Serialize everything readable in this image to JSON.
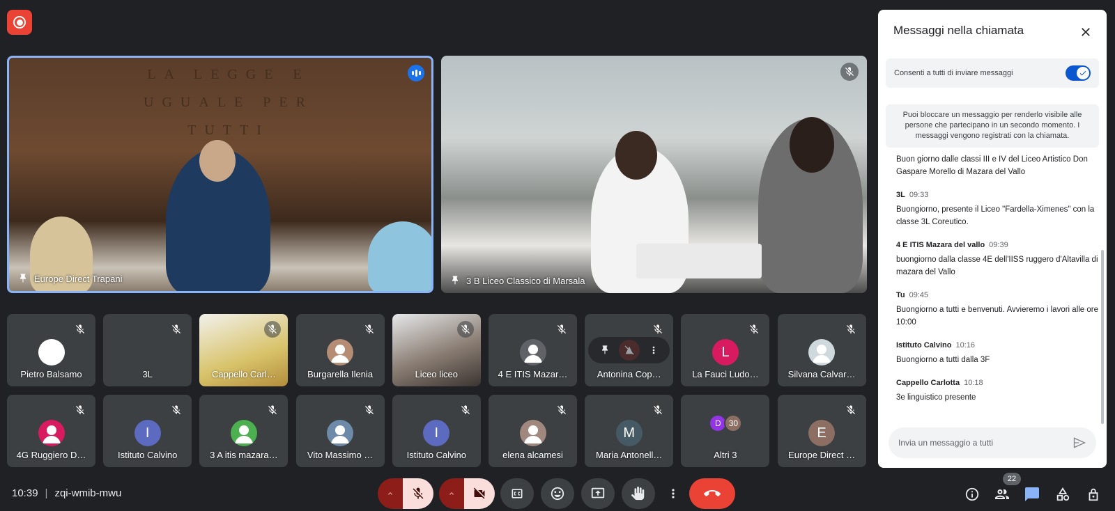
{
  "meeting": {
    "time": "10:39",
    "code": "zqi-wmib-mwu"
  },
  "main_tiles": [
    {
      "name": "Europe Direct Trapani",
      "wall_text": "LA LEGGE E UGUALE PER TUTTI",
      "speaking": true
    },
    {
      "name": "3 B Liceo Classico di Marsala",
      "muted": true
    }
  ],
  "participants_row1": [
    {
      "name": "Pietro Balsamo",
      "type": "photo-avatar",
      "color": "#ffffff"
    },
    {
      "name": "3L",
      "type": "video"
    },
    {
      "name": "Cappello Carl…",
      "type": "video"
    },
    {
      "name": "Burgarella Ilenia",
      "type": "photo-avatar",
      "color": "#b58c74"
    },
    {
      "name": "Liceo liceo",
      "type": "video"
    },
    {
      "name": "4 E ITIS Mazar…",
      "type": "default-avatar",
      "color": "#5f6368"
    },
    {
      "name": "Antonina Cop…",
      "type": "hover"
    },
    {
      "name": "La Fauci Ludo…",
      "type": "letter",
      "letter": "L",
      "color": "#d81b60"
    },
    {
      "name": "Silvana Calvar…",
      "type": "photo-avatar",
      "color": "#cfd8dc"
    }
  ],
  "participants_row2": [
    {
      "name": "4G Ruggiero D…",
      "type": "default-avatar",
      "color": "#d81b60"
    },
    {
      "name": "Istituto Calvino",
      "type": "letter",
      "letter": "I",
      "color": "#5c6bc0"
    },
    {
      "name": "3 A itis mazara…",
      "type": "default-avatar",
      "color": "#4caf50"
    },
    {
      "name": "Vito Massimo …",
      "type": "photo-avatar",
      "color": "#6d8aa8"
    },
    {
      "name": "Istituto Calvino",
      "type": "letter",
      "letter": "I",
      "color": "#5c6bc0"
    },
    {
      "name": "elena alcamesi",
      "type": "photo-avatar",
      "color": "#a1887f"
    },
    {
      "name": "Maria Antonell…",
      "type": "letter",
      "letter": "M",
      "color": "#455a64"
    },
    {
      "name": "Altri 3",
      "type": "others",
      "letter": "D",
      "count": "30",
      "color": "#9334e6",
      "color2": "#8d6e63"
    },
    {
      "name": "Europe Direct …",
      "type": "letter",
      "letter": "E",
      "color": "#8d6e63"
    }
  ],
  "panel": {
    "title": "Messaggi nella chiamata",
    "toggle_label": "Consenti a tutti di inviare messaggi",
    "toggle_on": true,
    "info": "Puoi bloccare un messaggio per renderlo visibile alle persone che partecipano in un secondo momento. I messaggi vengono registrati con la chiamata.",
    "first_message": "Buon giorno dalle classi III e IV del Liceo Artistico Don Gaspare Morello di Mazara del Vallo",
    "messages": [
      {
        "author": "3L",
        "time": "09:33",
        "text": "Buongiorno, presente il Liceo \"Fardella-Ximenes\" con la classe 3L Coreutico."
      },
      {
        "author": "4 E ITIS Mazara del vallo",
        "time": "09:39",
        "text": "buongiorno dalla classe 4E dell'IISS ruggero d'Altavilla di mazara del Vallo"
      },
      {
        "author": "Tu",
        "time": "09:45",
        "text": "Buongiorno a tutti e benvenuti. Avvieremo i lavori alle ore 10:00"
      },
      {
        "author": "Istituto Calvino",
        "time": "10:16",
        "text": "Buongiorno a tutti dalla 3F"
      },
      {
        "author": "Cappello Carlotta",
        "time": "10:18",
        "text": "3e linguistico presente"
      }
    ],
    "input_placeholder": "Invia un messaggio a tutti"
  },
  "toolbar": {
    "people_count": "22"
  },
  "colors": {
    "bg": "#202124",
    "tile": "#3c4043",
    "accent": "#8ab4f8",
    "end": "#ea4335",
    "chat_active": "#8ab4f8"
  }
}
